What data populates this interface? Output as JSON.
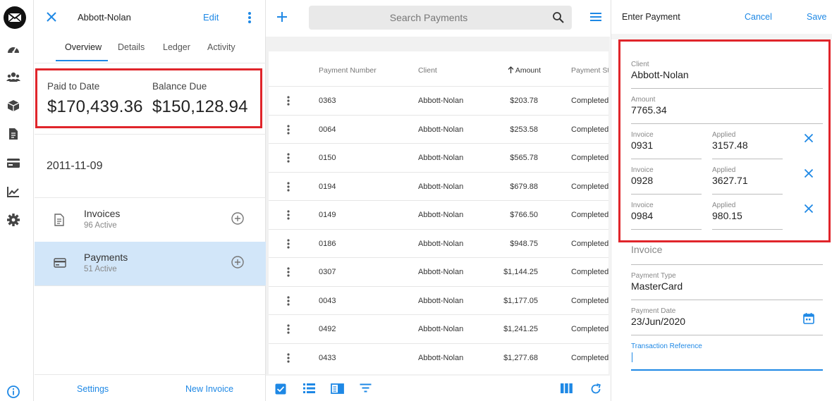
{
  "client_panel": {
    "title": "Abbott-Nolan",
    "edit_label": "Edit",
    "tabs": [
      "Overview",
      "Details",
      "Ledger",
      "Activity"
    ],
    "paid_to_date_label": "Paid to Date",
    "paid_to_date_value": "$170,439.36",
    "balance_due_label": "Balance Due",
    "balance_due_value": "$150,128.94",
    "date": "2011-11-09",
    "nav": [
      {
        "title": "Invoices",
        "subtitle": "96 Active"
      },
      {
        "title": "Payments",
        "subtitle": "51 Active"
      }
    ],
    "footer": {
      "settings": "Settings",
      "new_invoice": "New Invoice"
    }
  },
  "payments_list": {
    "search_placeholder": "Search Payments",
    "columns": [
      "Payment Number",
      "Client",
      "Amount",
      "Payment St"
    ],
    "rows": [
      {
        "number": "0363",
        "client": "Abbott-Nolan",
        "amount": "$203.78",
        "status": "Completed"
      },
      {
        "number": "0064",
        "client": "Abbott-Nolan",
        "amount": "$253.58",
        "status": "Completed"
      },
      {
        "number": "0150",
        "client": "Abbott-Nolan",
        "amount": "$565.78",
        "status": "Completed"
      },
      {
        "number": "0194",
        "client": "Abbott-Nolan",
        "amount": "$679.88",
        "status": "Completed"
      },
      {
        "number": "0149",
        "client": "Abbott-Nolan",
        "amount": "$766.50",
        "status": "Completed"
      },
      {
        "number": "0186",
        "client": "Abbott-Nolan",
        "amount": "$948.75",
        "status": "Completed"
      },
      {
        "number": "0307",
        "client": "Abbott-Nolan",
        "amount": "$1,144.25",
        "status": "Completed"
      },
      {
        "number": "0043",
        "client": "Abbott-Nolan",
        "amount": "$1,177.05",
        "status": "Completed"
      },
      {
        "number": "0492",
        "client": "Abbott-Nolan",
        "amount": "$1,241.25",
        "status": "Completed"
      },
      {
        "number": "0433",
        "client": "Abbott-Nolan",
        "amount": "$1,277.68",
        "status": "Completed"
      }
    ]
  },
  "entry_panel": {
    "title": "Enter Payment",
    "cancel_label": "Cancel",
    "save_label": "Save",
    "client_label": "Client",
    "client_value": "Abbott-Nolan",
    "amount_label": "Amount",
    "amount_value": "7765.34",
    "invoice_label": "Invoice",
    "applied_label": "Applied",
    "invoices": [
      {
        "invoice": "0931",
        "applied": "3157.48"
      },
      {
        "invoice": "0928",
        "applied": "3627.71"
      },
      {
        "invoice": "0984",
        "applied": "980.15"
      }
    ],
    "invoice_placeholder": "Invoice",
    "payment_type_label": "Payment Type",
    "payment_type_value": "MasterCard",
    "payment_date_label": "Payment Date",
    "payment_date_value": "23/Jun/2020",
    "transaction_reference_label": "Transaction Reference"
  },
  "colors": {
    "accent": "#1e88e5",
    "highlight_box": "#e0252b",
    "selected_row": "#d2e6f9"
  }
}
